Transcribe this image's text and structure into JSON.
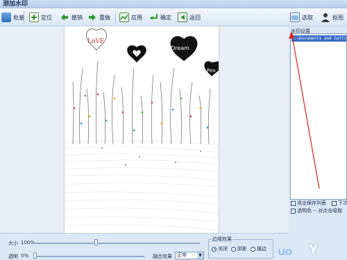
{
  "window": {
    "title": "添加水印"
  },
  "toolbar": {
    "batch": "批量",
    "locate": "定位",
    "undo": "撤销",
    "redo": "重做",
    "apply": "应用",
    "confirm": "确定",
    "back": "返回",
    "select": "选取",
    "crop": "抠图"
  },
  "right_panel": {
    "title": "水印设置",
    "watermark_item": "C:\\Documents and Settings",
    "exit_save_list": "退出保存列表",
    "next": "下次",
    "transparent_color": "透明色",
    "transparent_hint": "-- 对点击吸取"
  },
  "bottom": {
    "size_label": "大小",
    "size_value": "100%",
    "opacity_label": "透明",
    "opacity_value": "0%",
    "blend_label": "融合效果",
    "blend_value": "正常",
    "border_title": "边缘效果",
    "border_off": "关闭",
    "border_shadow": "阴影",
    "border_outline": "描边"
  },
  "overlay_watermark": {
    "text": "uo",
    "text2": "Y"
  },
  "artwork": {
    "words": [
      "LoVE",
      "Dream",
      "Peo"
    ]
  },
  "colors": {
    "accent": "#316ac5",
    "panel": "#dbe8f5",
    "red_line": "#d62020"
  }
}
